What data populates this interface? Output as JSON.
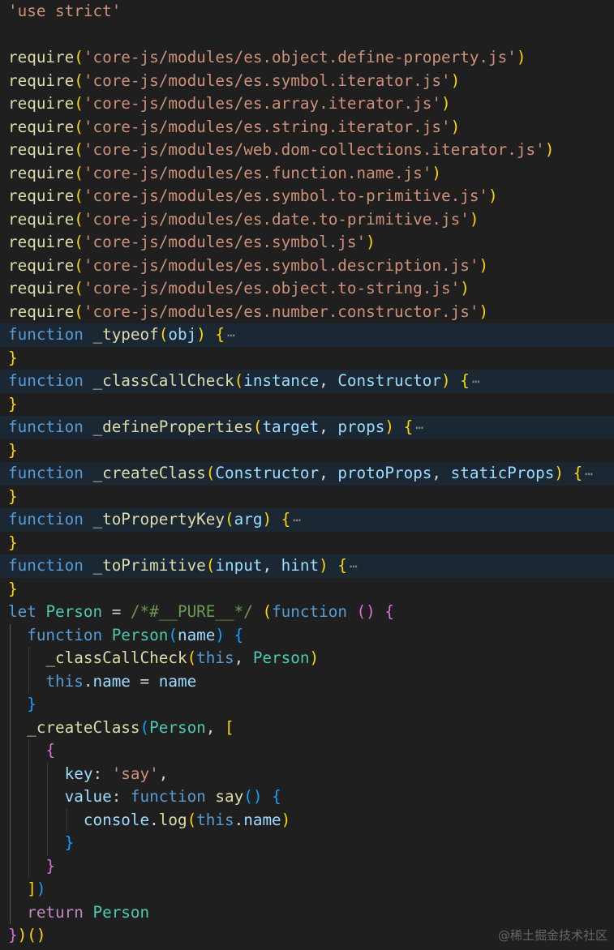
{
  "editor": {
    "colors": {
      "background": "#1f1f1f",
      "folded_line_bg": "#1b2733",
      "keyword": "#569cd6",
      "control": "#c586c0",
      "string": "#ce9178",
      "function": "#dcdcaa",
      "variable": "#9cdcfe",
      "class": "#4ec9b0",
      "comment": "#6a9955",
      "brace_1": "#ffd700",
      "brace_2": "#da70d6",
      "brace_3": "#179fff",
      "text": "#d4d4d4"
    },
    "lines": [
      {
        "tokens": [
          {
            "t": "'use strict'",
            "c": "string"
          }
        ]
      },
      {
        "tokens": []
      },
      {
        "tokens": [
          {
            "t": "require",
            "c": "function"
          },
          {
            "t": "(",
            "c": "brace_1"
          },
          {
            "t": "'core-js/modules/es.object.define-property.js'",
            "c": "string"
          },
          {
            "t": ")",
            "c": "brace_1"
          }
        ]
      },
      {
        "tokens": [
          {
            "t": "require",
            "c": "function"
          },
          {
            "t": "(",
            "c": "brace_1"
          },
          {
            "t": "'core-js/modules/es.symbol.iterator.js'",
            "c": "string"
          },
          {
            "t": ")",
            "c": "brace_1"
          }
        ]
      },
      {
        "tokens": [
          {
            "t": "require",
            "c": "function"
          },
          {
            "t": "(",
            "c": "brace_1"
          },
          {
            "t": "'core-js/modules/es.array.iterator.js'",
            "c": "string"
          },
          {
            "t": ")",
            "c": "brace_1"
          }
        ]
      },
      {
        "tokens": [
          {
            "t": "require",
            "c": "function"
          },
          {
            "t": "(",
            "c": "brace_1"
          },
          {
            "t": "'core-js/modules/es.string.iterator.js'",
            "c": "string"
          },
          {
            "t": ")",
            "c": "brace_1"
          }
        ]
      },
      {
        "tokens": [
          {
            "t": "require",
            "c": "function"
          },
          {
            "t": "(",
            "c": "brace_1"
          },
          {
            "t": "'core-js/modules/web.dom-collections.iterator.js'",
            "c": "string"
          },
          {
            "t": ")",
            "c": "brace_1"
          }
        ]
      },
      {
        "tokens": [
          {
            "t": "require",
            "c": "function"
          },
          {
            "t": "(",
            "c": "brace_1"
          },
          {
            "t": "'core-js/modules/es.function.name.js'",
            "c": "string"
          },
          {
            "t": ")",
            "c": "brace_1"
          }
        ]
      },
      {
        "tokens": [
          {
            "t": "require",
            "c": "function"
          },
          {
            "t": "(",
            "c": "brace_1"
          },
          {
            "t": "'core-js/modules/es.symbol.to-primitive.js'",
            "c": "string"
          },
          {
            "t": ")",
            "c": "brace_1"
          }
        ]
      },
      {
        "tokens": [
          {
            "t": "require",
            "c": "function"
          },
          {
            "t": "(",
            "c": "brace_1"
          },
          {
            "t": "'core-js/modules/es.date.to-primitive.js'",
            "c": "string"
          },
          {
            "t": ")",
            "c": "brace_1"
          }
        ]
      },
      {
        "tokens": [
          {
            "t": "require",
            "c": "function"
          },
          {
            "t": "(",
            "c": "brace_1"
          },
          {
            "t": "'core-js/modules/es.symbol.js'",
            "c": "string"
          },
          {
            "t": ")",
            "c": "brace_1"
          }
        ]
      },
      {
        "tokens": [
          {
            "t": "require",
            "c": "function"
          },
          {
            "t": "(",
            "c": "brace_1"
          },
          {
            "t": "'core-js/modules/es.symbol.description.js'",
            "c": "string"
          },
          {
            "t": ")",
            "c": "brace_1"
          }
        ]
      },
      {
        "tokens": [
          {
            "t": "require",
            "c": "function"
          },
          {
            "t": "(",
            "c": "brace_1"
          },
          {
            "t": "'core-js/modules/es.object.to-string.js'",
            "c": "string"
          },
          {
            "t": ")",
            "c": "brace_1"
          }
        ]
      },
      {
        "tokens": [
          {
            "t": "require",
            "c": "function"
          },
          {
            "t": "(",
            "c": "brace_1"
          },
          {
            "t": "'core-js/modules/es.number.constructor.js'",
            "c": "string"
          },
          {
            "t": ")",
            "c": "brace_1"
          }
        ]
      },
      {
        "folded": true,
        "tokens": [
          {
            "t": "function",
            "c": "keyword"
          },
          {
            "t": " ",
            "c": "text"
          },
          {
            "t": "_typeof",
            "c": "function"
          },
          {
            "t": "(",
            "c": "brace_1"
          },
          {
            "t": "obj",
            "c": "variable"
          },
          {
            "t": ")",
            "c": "brace_1"
          },
          {
            "t": " ",
            "c": "text"
          },
          {
            "t": "{",
            "c": "brace_1"
          }
        ]
      },
      {
        "tokens": [
          {
            "t": "}",
            "c": "brace_1"
          }
        ]
      },
      {
        "folded": true,
        "tokens": [
          {
            "t": "function",
            "c": "keyword"
          },
          {
            "t": " ",
            "c": "text"
          },
          {
            "t": "_classCallCheck",
            "c": "function"
          },
          {
            "t": "(",
            "c": "brace_1"
          },
          {
            "t": "instance",
            "c": "variable"
          },
          {
            "t": ", ",
            "c": "text"
          },
          {
            "t": "Constructor",
            "c": "variable"
          },
          {
            "t": ")",
            "c": "brace_1"
          },
          {
            "t": " ",
            "c": "text"
          },
          {
            "t": "{",
            "c": "brace_1"
          }
        ]
      },
      {
        "tokens": [
          {
            "t": "}",
            "c": "brace_1"
          }
        ]
      },
      {
        "folded": true,
        "tokens": [
          {
            "t": "function",
            "c": "keyword"
          },
          {
            "t": " ",
            "c": "text"
          },
          {
            "t": "_defineProperties",
            "c": "function"
          },
          {
            "t": "(",
            "c": "brace_1"
          },
          {
            "t": "target",
            "c": "variable"
          },
          {
            "t": ", ",
            "c": "text"
          },
          {
            "t": "props",
            "c": "variable"
          },
          {
            "t": ")",
            "c": "brace_1"
          },
          {
            "t": " ",
            "c": "text"
          },
          {
            "t": "{",
            "c": "brace_1"
          }
        ]
      },
      {
        "tokens": [
          {
            "t": "}",
            "c": "brace_1"
          }
        ]
      },
      {
        "folded": true,
        "tokens": [
          {
            "t": "function",
            "c": "keyword"
          },
          {
            "t": " ",
            "c": "text"
          },
          {
            "t": "_createClass",
            "c": "function"
          },
          {
            "t": "(",
            "c": "brace_1"
          },
          {
            "t": "Constructor",
            "c": "variable"
          },
          {
            "t": ", ",
            "c": "text"
          },
          {
            "t": "protoProps",
            "c": "variable"
          },
          {
            "t": ", ",
            "c": "text"
          },
          {
            "t": "staticProps",
            "c": "variable"
          },
          {
            "t": ")",
            "c": "brace_1"
          },
          {
            "t": " ",
            "c": "text"
          },
          {
            "t": "{",
            "c": "brace_1"
          }
        ]
      },
      {
        "tokens": [
          {
            "t": "}",
            "c": "brace_1"
          }
        ]
      },
      {
        "folded": true,
        "tokens": [
          {
            "t": "function",
            "c": "keyword"
          },
          {
            "t": " ",
            "c": "text"
          },
          {
            "t": "_toPropertyKey",
            "c": "function"
          },
          {
            "t": "(",
            "c": "brace_1"
          },
          {
            "t": "arg",
            "c": "variable"
          },
          {
            "t": ")",
            "c": "brace_1"
          },
          {
            "t": " ",
            "c": "text"
          },
          {
            "t": "{",
            "c": "brace_1"
          }
        ]
      },
      {
        "tokens": [
          {
            "t": "}",
            "c": "brace_1"
          }
        ]
      },
      {
        "folded": true,
        "tokens": [
          {
            "t": "function",
            "c": "keyword"
          },
          {
            "t": " ",
            "c": "text"
          },
          {
            "t": "_toPrimitive",
            "c": "function"
          },
          {
            "t": "(",
            "c": "brace_1"
          },
          {
            "t": "input",
            "c": "variable"
          },
          {
            "t": ", ",
            "c": "text"
          },
          {
            "t": "hint",
            "c": "variable"
          },
          {
            "t": ")",
            "c": "brace_1"
          },
          {
            "t": " ",
            "c": "text"
          },
          {
            "t": "{",
            "c": "brace_1"
          }
        ]
      },
      {
        "tokens": [
          {
            "t": "}",
            "c": "brace_1"
          }
        ]
      },
      {
        "tokens": [
          {
            "t": "let",
            "c": "keyword"
          },
          {
            "t": " ",
            "c": "text"
          },
          {
            "t": "Person",
            "c": "class"
          },
          {
            "t": " = ",
            "c": "text"
          },
          {
            "t": "/*#__PURE__*/",
            "c": "comment"
          },
          {
            "t": " ",
            "c": "text"
          },
          {
            "t": "(",
            "c": "brace_1"
          },
          {
            "t": "function",
            "c": "keyword"
          },
          {
            "t": " ",
            "c": "text"
          },
          {
            "t": "()",
            "c": "brace_2"
          },
          {
            "t": " ",
            "c": "text"
          },
          {
            "t": "{",
            "c": "brace_2"
          }
        ]
      },
      {
        "tokens": [
          {
            "t": "  ",
            "c": "text"
          },
          {
            "t": "function",
            "c": "keyword"
          },
          {
            "t": " ",
            "c": "text"
          },
          {
            "t": "Person",
            "c": "class"
          },
          {
            "t": "(",
            "c": "brace_3"
          },
          {
            "t": "name",
            "c": "variable"
          },
          {
            "t": ")",
            "c": "brace_3"
          },
          {
            "t": " ",
            "c": "text"
          },
          {
            "t": "{",
            "c": "brace_3"
          }
        ]
      },
      {
        "tokens": [
          {
            "t": "    ",
            "c": "text"
          },
          {
            "t": "_classCallCheck",
            "c": "function"
          },
          {
            "t": "(",
            "c": "brace_1"
          },
          {
            "t": "this",
            "c": "keyword"
          },
          {
            "t": ", ",
            "c": "text"
          },
          {
            "t": "Person",
            "c": "class"
          },
          {
            "t": ")",
            "c": "brace_1"
          }
        ]
      },
      {
        "tokens": [
          {
            "t": "    ",
            "c": "text"
          },
          {
            "t": "this",
            "c": "keyword"
          },
          {
            "t": ".",
            "c": "text"
          },
          {
            "t": "name",
            "c": "variable"
          },
          {
            "t": " = ",
            "c": "text"
          },
          {
            "t": "name",
            "c": "variable"
          }
        ]
      },
      {
        "tokens": [
          {
            "t": "  ",
            "c": "text"
          },
          {
            "t": "}",
            "c": "brace_3"
          }
        ]
      },
      {
        "tokens": [
          {
            "t": "  ",
            "c": "text"
          },
          {
            "t": "_createClass",
            "c": "function"
          },
          {
            "t": "(",
            "c": "brace_3"
          },
          {
            "t": "Person",
            "c": "class"
          },
          {
            "t": ", ",
            "c": "text"
          },
          {
            "t": "[",
            "c": "brace_1"
          }
        ]
      },
      {
        "tokens": [
          {
            "t": "    ",
            "c": "text"
          },
          {
            "t": "{",
            "c": "brace_2"
          }
        ]
      },
      {
        "tokens": [
          {
            "t": "      ",
            "c": "text"
          },
          {
            "t": "key",
            "c": "variable"
          },
          {
            "t": ": ",
            "c": "text"
          },
          {
            "t": "'say'",
            "c": "string"
          },
          {
            "t": ",",
            "c": "text"
          }
        ]
      },
      {
        "tokens": [
          {
            "t": "      ",
            "c": "text"
          },
          {
            "t": "value",
            "c": "variable"
          },
          {
            "t": ": ",
            "c": "text"
          },
          {
            "t": "function",
            "c": "keyword"
          },
          {
            "t": " ",
            "c": "text"
          },
          {
            "t": "say",
            "c": "function"
          },
          {
            "t": "()",
            "c": "brace_3"
          },
          {
            "t": " ",
            "c": "text"
          },
          {
            "t": "{",
            "c": "brace_3"
          }
        ]
      },
      {
        "tokens": [
          {
            "t": "        ",
            "c": "text"
          },
          {
            "t": "console",
            "c": "variable"
          },
          {
            "t": ".",
            "c": "text"
          },
          {
            "t": "log",
            "c": "function"
          },
          {
            "t": "(",
            "c": "brace_1"
          },
          {
            "t": "this",
            "c": "keyword"
          },
          {
            "t": ".",
            "c": "text"
          },
          {
            "t": "name",
            "c": "variable"
          },
          {
            "t": ")",
            "c": "brace_1"
          }
        ]
      },
      {
        "tokens": [
          {
            "t": "      ",
            "c": "text"
          },
          {
            "t": "}",
            "c": "brace_3"
          }
        ]
      },
      {
        "tokens": [
          {
            "t": "    ",
            "c": "text"
          },
          {
            "t": "}",
            "c": "brace_2"
          }
        ]
      },
      {
        "tokens": [
          {
            "t": "  ",
            "c": "text"
          },
          {
            "t": "]",
            "c": "brace_1"
          },
          {
            "t": ")",
            "c": "brace_3"
          }
        ]
      },
      {
        "tokens": [
          {
            "t": "  ",
            "c": "text"
          },
          {
            "t": "return",
            "c": "control"
          },
          {
            "t": " ",
            "c": "text"
          },
          {
            "t": "Person",
            "c": "class"
          }
        ]
      },
      {
        "tokens": [
          {
            "t": "}",
            "c": "brace_2"
          },
          {
            "t": ")",
            "c": "brace_1"
          },
          {
            "t": "()",
            "c": "brace_1"
          }
        ]
      }
    ],
    "fold_indicator": "⋯"
  },
  "watermark": "@稀土掘金技术社区"
}
